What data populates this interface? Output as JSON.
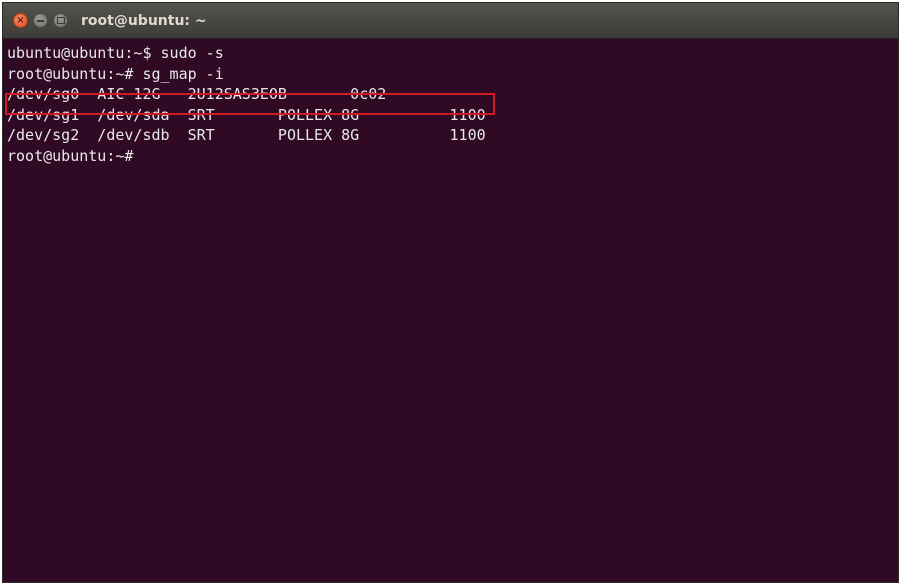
{
  "window": {
    "title": "root@ubuntu: ~",
    "close_glyph": "×",
    "colors": {
      "terminal_bg": "#300a24",
      "text": "#e8e8e8",
      "highlight": "#d01a26",
      "titlebar": "#4a4844",
      "close_button": "#df4b16"
    }
  },
  "terminal": {
    "lines": [
      "ubuntu@ubuntu:~$ sudo -s",
      "root@ubuntu:~# sg_map -i",
      "/dev/sg0  AIC 12G   2U12SAS3EOB       0c02",
      "/dev/sg1  /dev/sda  SRT       POLLEX 8G          1100",
      "/dev/sg2  /dev/sdb  SRT       POLLEX 8G          1100",
      "root@ubuntu:~#"
    ],
    "highlighted_line_index": 2
  }
}
